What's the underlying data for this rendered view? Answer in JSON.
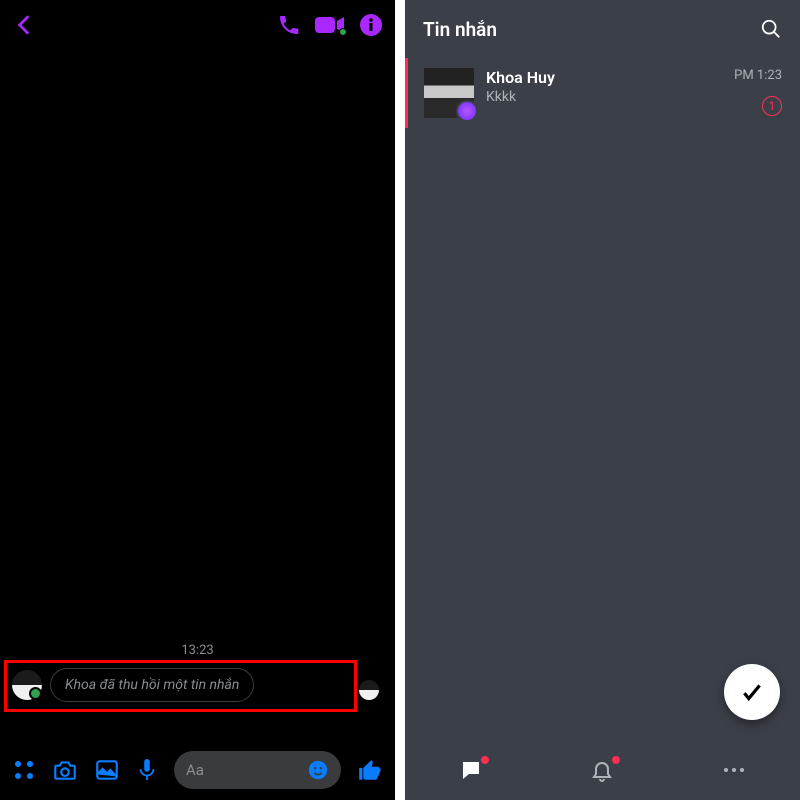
{
  "left": {
    "accent": "#a928ff",
    "timestamp": "13:23",
    "retracted_message": "Khoa đã thu hồi một tin nhắn",
    "compose_placeholder": "Aa"
  },
  "right": {
    "title": "Tin nhắn",
    "conversation": {
      "name": "Khoa Huy",
      "preview": "Kkkk",
      "time": "PM 1:23",
      "badge": "1"
    }
  }
}
